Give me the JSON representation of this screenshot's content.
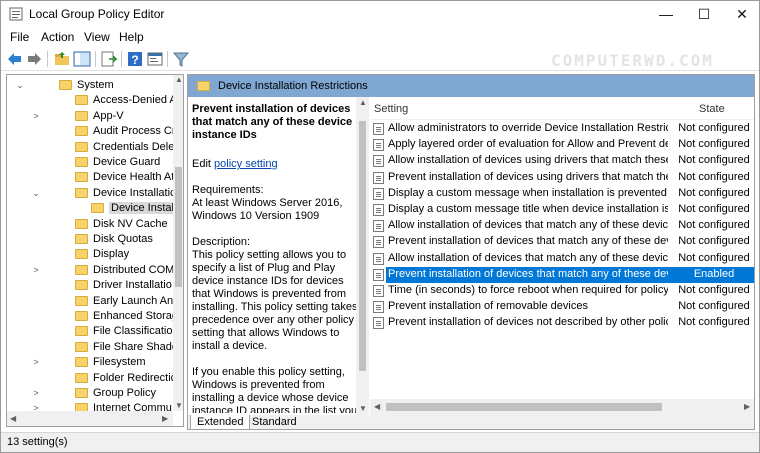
{
  "window": {
    "title": "Local Group Policy Editor",
    "minimize": "—",
    "maximize": "☐",
    "close": "✕"
  },
  "watermark": "COMPUTERWD.COM",
  "menu": [
    "File",
    "Action",
    "View",
    "Help"
  ],
  "tree": {
    "items": [
      {
        "label": "System",
        "expander": "⌄",
        "level": 0
      },
      {
        "label": "Access-Denied A",
        "expander": "",
        "level": 1
      },
      {
        "label": "App-V",
        "expander": ">",
        "level": 1
      },
      {
        "label": "Audit Process Cr",
        "expander": "",
        "level": 1
      },
      {
        "label": "Credentials Dele",
        "expander": "",
        "level": 1
      },
      {
        "label": "Device Guard",
        "expander": "",
        "level": 1
      },
      {
        "label": "Device Health At",
        "expander": "",
        "level": 1
      },
      {
        "label": "Device Installatic",
        "expander": "⌄",
        "level": 1
      },
      {
        "label": "Device Install",
        "expander": "",
        "level": 2,
        "selected": true
      },
      {
        "label": "Disk NV Cache",
        "expander": "",
        "level": 1
      },
      {
        "label": "Disk Quotas",
        "expander": "",
        "level": 1
      },
      {
        "label": "Display",
        "expander": "",
        "level": 1
      },
      {
        "label": "Distributed COM",
        "expander": ">",
        "level": 1
      },
      {
        "label": "Driver Installatio",
        "expander": "",
        "level": 1
      },
      {
        "label": "Early Launch Ant",
        "expander": "",
        "level": 1
      },
      {
        "label": "Enhanced Storag",
        "expander": "",
        "level": 1
      },
      {
        "label": "File Classification",
        "expander": "",
        "level": 1
      },
      {
        "label": "File Share Shado",
        "expander": "",
        "level": 1
      },
      {
        "label": "Filesystem",
        "expander": ">",
        "level": 1
      },
      {
        "label": "Folder Redirectic",
        "expander": "",
        "level": 1
      },
      {
        "label": "Group Policy",
        "expander": ">",
        "level": 1
      },
      {
        "label": "Internet Commu",
        "expander": ">",
        "level": 1
      }
    ]
  },
  "header": {
    "title": "Device Installation Restrictions"
  },
  "description": {
    "title": "Prevent installation of devices that match any of these device instance IDs",
    "edit_prefix": "Edit ",
    "edit_link": "policy setting",
    "requirements_label": "Requirements:",
    "requirements_text": "At least Windows Server 2016, Windows 10 Version 1909",
    "description_label": "Description:",
    "description_text": "This policy setting allows you to specify a list of Plug and Play device instance IDs for devices that Windows is prevented from installing. This policy setting takes precedence over any other policy setting that allows Windows to install a device.",
    "enable_text": "If you enable this policy setting, Windows is prevented from installing a device whose device instance ID appears in the list you"
  },
  "list": {
    "col_setting": "Setting",
    "col_state": "State",
    "rows": [
      {
        "name": "Allow administrators to override Device Installation Restricti...",
        "state": "Not configured"
      },
      {
        "name": "Apply layered order of evaluation for Allow and Prevent devi...",
        "state": "Not configured"
      },
      {
        "name": "Allow installation of devices using drivers that match these ...",
        "state": "Not configured"
      },
      {
        "name": "Prevent installation of devices using drivers that match thes...",
        "state": "Not configured"
      },
      {
        "name": "Display a custom message when installation is prevented by...",
        "state": "Not configured"
      },
      {
        "name": "Display a custom message title when device installation is pr...",
        "state": "Not configured"
      },
      {
        "name": "Allow installation of devices that match any of these device ...",
        "state": "Not configured"
      },
      {
        "name": "Prevent installation of devices that match any of these devic...",
        "state": "Not configured"
      },
      {
        "name": "Allow installation of devices that match any of these device ...",
        "state": "Not configured"
      },
      {
        "name": "Prevent installation of devices that match any of these devic...",
        "state": "Enabled",
        "selected": true
      },
      {
        "name": "Time (in seconds) to force reboot when required for policy c...",
        "state": "Not configured"
      },
      {
        "name": "Prevent installation of removable devices",
        "state": "Not configured"
      },
      {
        "name": "Prevent installation of devices not described by other policy ...",
        "state": "Not configured"
      }
    ]
  },
  "tabs": [
    "Extended",
    "Standard"
  ],
  "status": "13 setting(s)"
}
